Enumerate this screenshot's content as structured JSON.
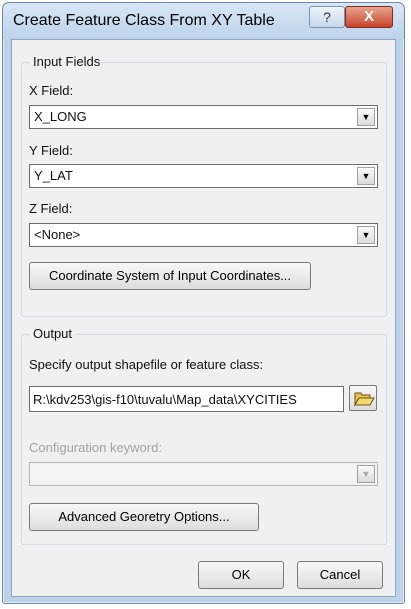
{
  "window": {
    "title": "Create Feature Class From XY Table",
    "help_glyph": "?",
    "close_glyph": "X"
  },
  "input_fields": {
    "legend": "Input Fields",
    "x_label": "X Field:",
    "x_value": "X_LONG",
    "y_label": "Y Field:",
    "y_value": "Y_LAT",
    "z_label": "Z Field:",
    "z_value": "<None>",
    "coord_button": "Coordinate System of Input Coordinates..."
  },
  "output": {
    "legend": "Output",
    "specify_label": "Specify output shapefile or feature class:",
    "path_value": "R:\\kdv253\\gis-f10\\tuvalu\\Map_data\\XYCITIES",
    "config_label": "Configuration keyword:",
    "config_value": "",
    "advanced_button": "Advanced Georetry Options..."
  },
  "buttons": {
    "ok": "OK",
    "cancel": "Cancel"
  },
  "icons": {
    "combo_arrow": "▼",
    "folder": "open-folder-icon"
  }
}
